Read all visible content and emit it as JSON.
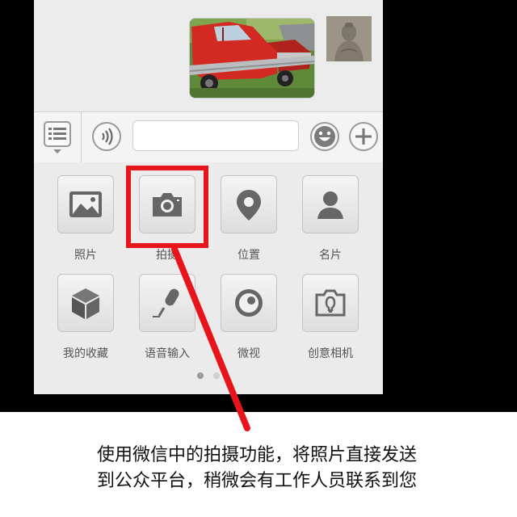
{
  "chat": {
    "image": "car-crash-photo",
    "avatar": "buddha-statue-avatar"
  },
  "input_bar": {
    "menu_icon": "list-menu-icon",
    "voice_icon": "voice-waves-icon",
    "text_value": "",
    "emoji_icon": "smiley-icon",
    "plus_icon": "plus-icon"
  },
  "panel": {
    "items": [
      {
        "label": "照片",
        "icon": "photo-icon"
      },
      {
        "label": "拍摄",
        "icon": "camera-icon"
      },
      {
        "label": "位置",
        "icon": "location-pin-icon"
      },
      {
        "label": "名片",
        "icon": "contact-card-icon"
      },
      {
        "label": "我的收藏",
        "icon": "cube-icon"
      },
      {
        "label": "语音输入",
        "icon": "microphone-icon"
      },
      {
        "label": "微视",
        "icon": "video-eye-icon"
      },
      {
        "label": "创意相机",
        "icon": "creative-camera-icon"
      }
    ],
    "page_dots": {
      "count": 2,
      "active": 0
    }
  },
  "annotation": {
    "color": "#e8141b",
    "caption_line1": "使用微信中的拍摄功能，将照片直接发送",
    "caption_line2": "到公众平台，稍微会有工作人员联系到您"
  }
}
